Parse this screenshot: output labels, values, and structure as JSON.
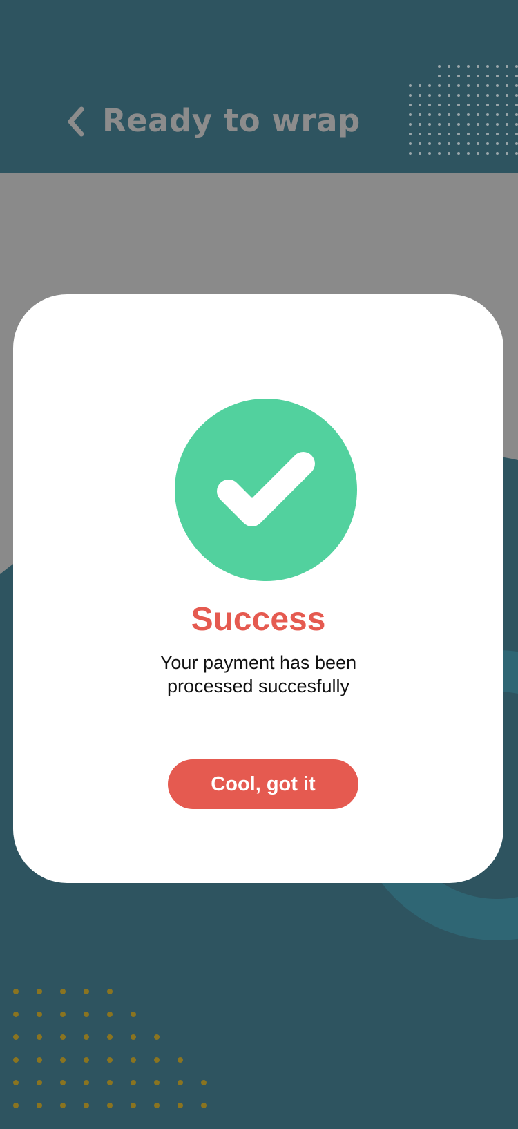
{
  "header": {
    "title": "Ready to wrap",
    "back_icon": "chevron-left-icon"
  },
  "dialog": {
    "icon": "check-circle-icon",
    "title": "Success",
    "message_line1": "Your payment has been",
    "message_line2": "processed succesfully",
    "button_label": "Cool, got it"
  },
  "colors": {
    "background": "#2e5460",
    "overlay": "#8a8a8a",
    "accent_red": "#e55a50",
    "success_green": "#52d19e",
    "header_title": "#8c8c8c",
    "bottom_dots": "#8a7420",
    "top_dots": "#9aa6aa"
  }
}
